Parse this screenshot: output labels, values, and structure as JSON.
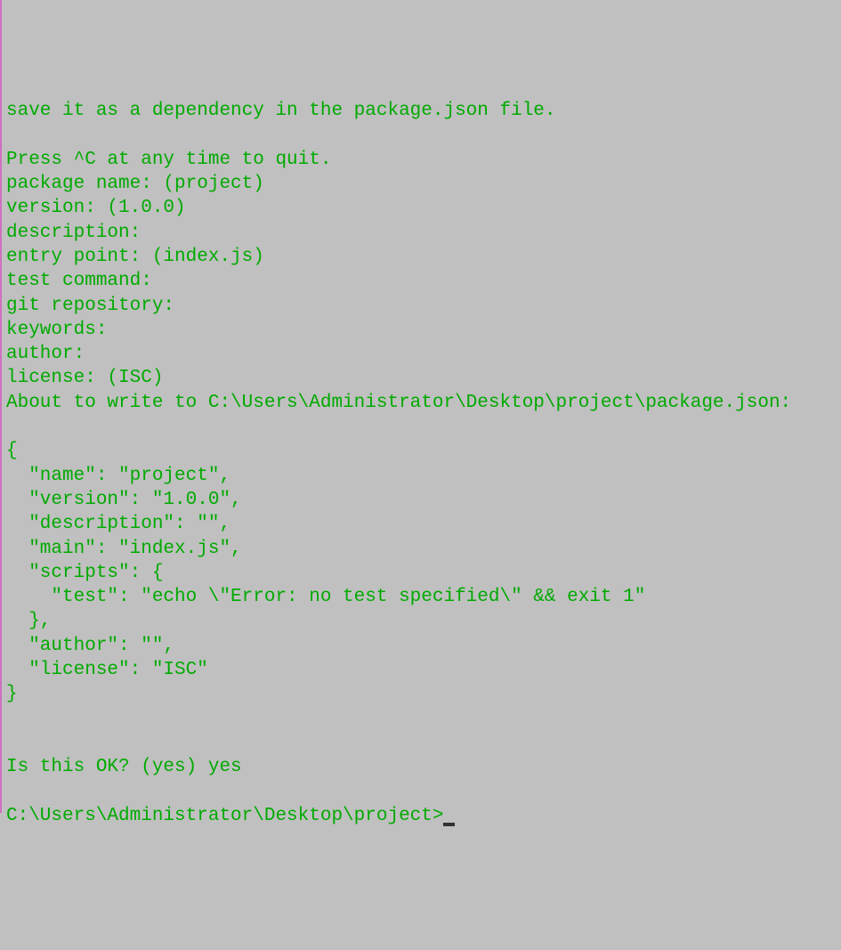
{
  "terminal": {
    "lines": {
      "l0": "save it as a dependency in the package.json file.",
      "l1": "",
      "l2": "Press ^C at any time to quit.",
      "l3": "package name: (project)",
      "l4": "version: (1.0.0)",
      "l5": "description:",
      "l6": "entry point: (index.js)",
      "l7": "test command:",
      "l8": "git repository:",
      "l9": "keywords:",
      "l10": "author:",
      "l11": "license: (ISC)",
      "l12": "About to write to C:\\Users\\Administrator\\Desktop\\project\\package.json:",
      "l13": "",
      "l14": "{",
      "l15": "  \"name\": \"project\",",
      "l16": "  \"version\": \"1.0.0\",",
      "l17": "  \"description\": \"\",",
      "l18": "  \"main\": \"index.js\",",
      "l19": "  \"scripts\": {",
      "l20": "    \"test\": \"echo \\\"Error: no test specified\\\" && exit 1\"",
      "l21": "  },",
      "l22": "  \"author\": \"\",",
      "l23": "  \"license\": \"ISC\"",
      "l24": "}",
      "l25": "",
      "l26": "",
      "l27": "Is this OK? (yes) yes",
      "l28": "",
      "l29": "C:\\Users\\Administrator\\Desktop\\project>"
    }
  }
}
